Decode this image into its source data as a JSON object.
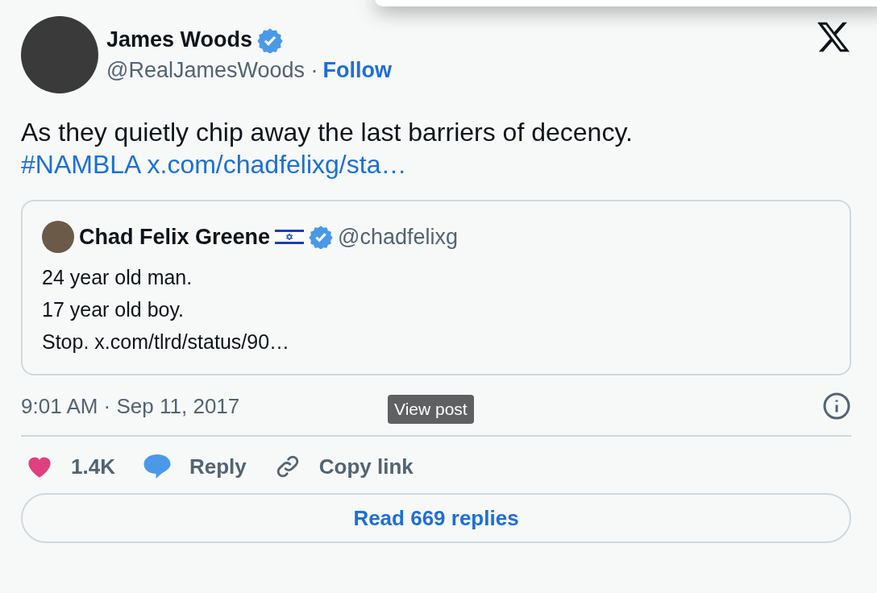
{
  "author": {
    "name": "James Woods",
    "verified": true,
    "handle": "@RealJamesWoods",
    "separator": "·",
    "follow": "Follow"
  },
  "post": {
    "text": "As they quietly chip away the last barriers of decency.",
    "hashtag": "#NAMBLA",
    "link": "x.com/chadfelixg/sta…"
  },
  "quote": {
    "name": "Chad Felix Greene",
    "verified": true,
    "handle": "@chadfelixg",
    "lines": [
      "24 year old man.",
      "17 year old boy.",
      "Stop. x.com/tlrd/status/90…"
    ]
  },
  "tooltip": "View post",
  "timestamp": "9:01 AM · Sep 11, 2017",
  "actions": [
    {
      "kind": "like",
      "label": "1.4K"
    },
    {
      "kind": "reply",
      "label": "Reply"
    },
    {
      "kind": "copy",
      "label": "Copy link"
    }
  ],
  "read_replies": "Read 669 replies"
}
